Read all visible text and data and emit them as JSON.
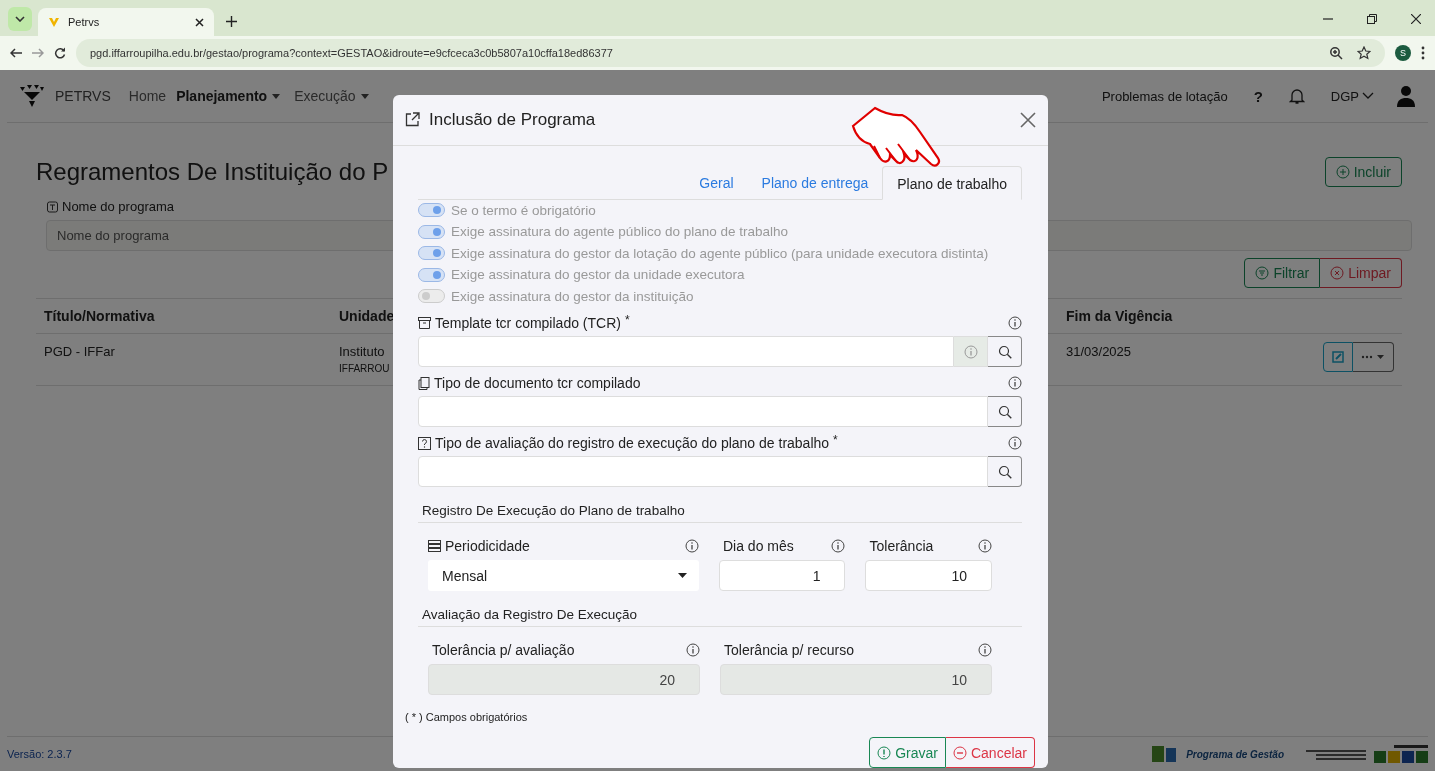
{
  "browser": {
    "tab_title": "Petrvs",
    "url": "pgd.iffarroupilha.edu.br/gestao/programa?context=GESTAO&idroute=e9cfceca3c0b5807a10cffa18ed86377",
    "profile_initial": "S"
  },
  "app_header": {
    "brand": "PETRVS",
    "nav": [
      {
        "label": "Home",
        "selected": false,
        "dropdown": false
      },
      {
        "label": "Planejamento",
        "selected": true,
        "dropdown": true
      },
      {
        "label": "Execução",
        "selected": false,
        "dropdown": true
      }
    ],
    "right_link": "Problemas de lotação",
    "help": "?",
    "unit": "DGP"
  },
  "page": {
    "title": "Regramentos De Instituição do P",
    "include_button": "Incluir",
    "filter_label": "Nome do programa",
    "filter_placeholder": "Nome do programa",
    "filter_button": "Filtrar",
    "clear_button": "Limpar",
    "table": {
      "columns": [
        "Título/Normativa",
        "Unidade",
        "Fim da Vigência"
      ],
      "rows": [
        {
          "title": "PGD - IFFar",
          "unit": "Instituto",
          "unit_code": "IFFARROU",
          "end": "31/03/2025"
        }
      ]
    }
  },
  "footer": {
    "version": "Versão: 2.3.7",
    "program": "Programa de Gestão"
  },
  "modal": {
    "title": "Inclusão de Programa",
    "tabs": [
      {
        "label": "Geral",
        "selected": false
      },
      {
        "label": "Plano de entrega",
        "selected": false
      },
      {
        "label": "Plano de trabalho",
        "selected": true
      }
    ],
    "toggles": [
      {
        "label": "Se o termo é obrigatório",
        "on": true
      },
      {
        "label": "Exige assinatura do agente público do plano de trabalho",
        "on": true
      },
      {
        "label": "Exige assinatura do gestor da lotação do agente público (para unidade executora distinta)",
        "on": true
      },
      {
        "label": "Exige assinatura do gestor da unidade executora",
        "on": true
      },
      {
        "label": "Exige assinatura do gestor da instituição",
        "on": false
      }
    ],
    "fields": [
      {
        "label": "Template tcr compilado (TCR)",
        "required": true,
        "info_button": true
      },
      {
        "label": "Tipo de documento tcr compilado",
        "required": false,
        "info_button": false
      },
      {
        "label": "Tipo de avaliação do registro de execução do plano de trabalho",
        "required": true,
        "info_button": false
      }
    ],
    "sections": [
      {
        "title": "Registro De Execução do Plano de trabalho",
        "inputs": [
          {
            "kind": "select",
            "label": "Periodicidade",
            "value": "Mensal",
            "disabled": false
          },
          {
            "kind": "number",
            "label": "Dia do mês",
            "value": "1",
            "disabled": false
          },
          {
            "kind": "number",
            "label": "Tolerância",
            "value": "10",
            "disabled": false
          }
        ]
      },
      {
        "title": "Avaliação da Registro De Execução",
        "inputs": [
          {
            "kind": "number",
            "label": "Tolerância p/ avaliação",
            "value": "20",
            "disabled": true
          },
          {
            "kind": "number",
            "label": "Tolerância p/ recurso",
            "value": "10",
            "disabled": true
          }
        ]
      }
    ],
    "required_mark": "*",
    "required_note": "( * ) Campos obrigatórios",
    "save_button": "Gravar",
    "cancel_button": "Cancelar"
  }
}
